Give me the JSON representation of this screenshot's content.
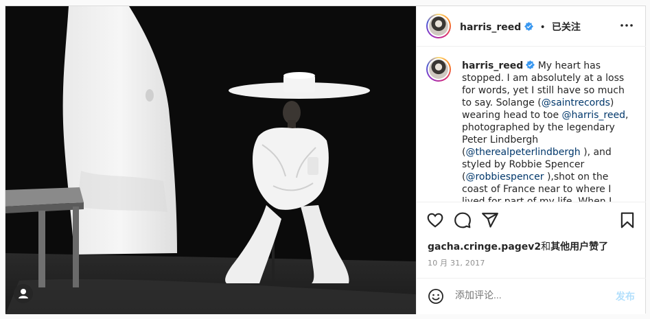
{
  "header": {
    "username": "harris_reed",
    "dot": "•",
    "follow_status": "已关注"
  },
  "caption": {
    "username": "harris_reed",
    "segments": [
      {
        "t": " My heart has stopped. I am absolutely at a loss for words, yet I still have so much to say. Solange (",
        "m": false
      },
      {
        "t": "@saintrecords",
        "m": true
      },
      {
        "t": ") wearing head to toe ",
        "m": false
      },
      {
        "t": "@harris_reed",
        "m": true
      },
      {
        "t": ", photographed by the legendary Peter Lindbergh (",
        "m": false
      },
      {
        "t": "@therealpeterlindbergh",
        "m": true
      },
      {
        "t": " ), and styled by Robbie Spencer (",
        "m": false
      },
      {
        "t": "@robbiespencer",
        "m": true
      },
      {
        "t": " ),shot on the coast of France near to where I lived for part of my life. When I found",
        "m": false
      }
    ]
  },
  "likes": {
    "user": "gacha.cringe.pagev2",
    "conjunction": "和",
    "others": "其他用户",
    "suffix": "赞了"
  },
  "date": "10 月 31, 2017",
  "comment": {
    "placeholder": "添加评论...",
    "post_label": "发布"
  },
  "icons": {
    "verified": "verified-badge-icon",
    "more": "more-options-icon",
    "like": "heart-icon",
    "comment": "comment-icon",
    "share": "paper-plane-icon",
    "save": "bookmark-icon",
    "emoji": "emoji-icon",
    "user_tag": "user-tag-icon"
  },
  "colors": {
    "verified_blue": "#3897f0",
    "mention": "#00376b",
    "post_button": "#b2dffc"
  }
}
